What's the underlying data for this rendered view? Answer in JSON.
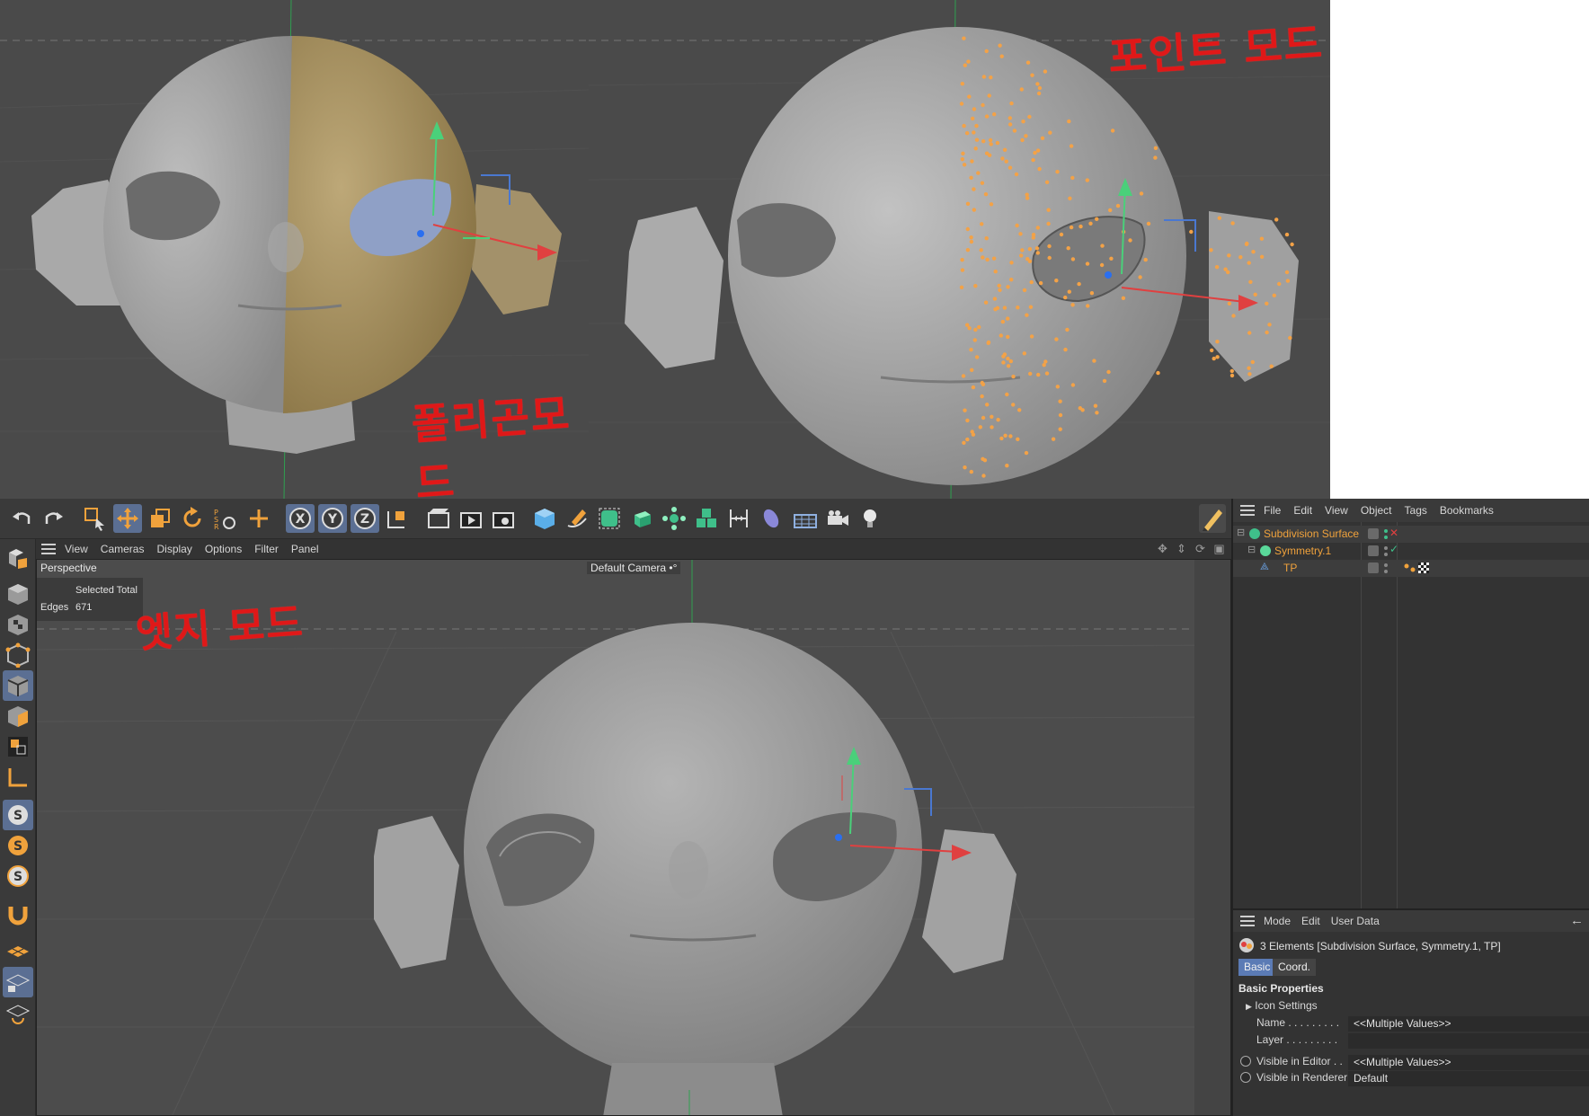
{
  "annotations": {
    "polygon_mode": "폴리곤모드",
    "point_mode": "포인트 모드",
    "edge_mode": "엣지 모드"
  },
  "toolbar": {
    "tools": [
      "undo-icon",
      "redo-icon",
      "live-selection-icon",
      "move-icon",
      "scale-icon",
      "rotate-icon",
      "psr-icon",
      "add-icon",
      "lock-x-icon",
      "lock-y-icon",
      "lock-z-icon",
      "coordinate-system-icon",
      "render-view-icon",
      "render-picture-viewer-icon",
      "render-settings-icon",
      "cube-icon",
      "pen-icon",
      "subdivision-icon",
      "extrude-icon",
      "array-icon",
      "cloner-icon",
      "symmetry-icon",
      "deformer-icon",
      "floor-icon",
      "camera-icon",
      "light-icon"
    ],
    "lock_labels": {
      "x": "X",
      "y": "Y",
      "z": "Z"
    }
  },
  "leftbar": {
    "tools": [
      "make-editable-icon",
      "model-mode-icon",
      "texture-mode-icon",
      "points-mode-icon",
      "edges-mode-icon",
      "polygons-mode-icon",
      "uv-mode-icon",
      "workplane-icon",
      "snap-icon",
      "solo-icon",
      "solo-hierarchy-icon",
      "magnet-icon",
      "grid-icon",
      "workplane-lock-icon",
      "sculpt-icon"
    ]
  },
  "viewport": {
    "menu": [
      "View",
      "Cameras",
      "Display",
      "Options",
      "Filter",
      "Panel"
    ],
    "projection": "Perspective",
    "camera": "Default Camera",
    "camera_suffix": "•°",
    "info": {
      "header": "Selected Total",
      "label": "Edges",
      "value": "671"
    }
  },
  "object_manager": {
    "menu": [
      "File",
      "Edit",
      "View",
      "Object",
      "Tags",
      "Bookmarks"
    ],
    "objects": [
      {
        "name": "Subdivision Surface",
        "indent": 0
      },
      {
        "name": "Symmetry.1",
        "indent": 1
      },
      {
        "name": "TP",
        "indent": 2
      }
    ]
  },
  "attributes": {
    "menu": [
      "Mode",
      "Edit",
      "User Data"
    ],
    "back_icon": "←",
    "title": "3 Elements [Subdivision Surface, Symmetry.1, TP]",
    "tabs": [
      "Basic",
      "Coord."
    ],
    "section": "Basic Properties",
    "subsection": "Icon Settings",
    "fields": [
      {
        "label": "Name . . . . . . . . .",
        "value": "<<Multiple Values>>"
      },
      {
        "label": "Layer . . . . . . . . .",
        "value": ""
      },
      {
        "label": "Visible in Editor . .",
        "value": "<<Multiple Values>>"
      },
      {
        "label": "Visible in Renderer",
        "value": "Default"
      }
    ]
  },
  "colors": {
    "selection_orange": "#f0a23c",
    "active_blue": "#5b6f93",
    "annotation_red": "#e01818"
  }
}
